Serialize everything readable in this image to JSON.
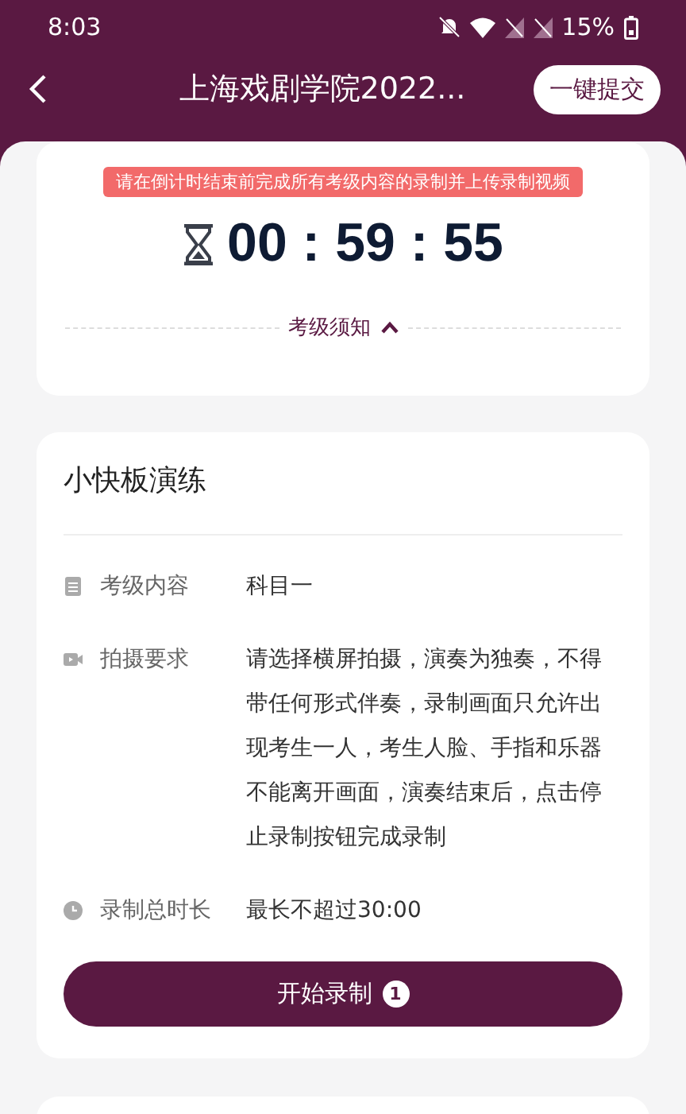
{
  "status_bar": {
    "time": "8:03",
    "battery": "15%"
  },
  "header": {
    "title": "上海戏剧学院2022...",
    "submit_button": "一键提交"
  },
  "timer": {
    "tip": "请在倒计时结束前完成所有考级内容的录制并上传录制视频",
    "countdown": "00 : 59 : 55",
    "notice": "考级须知",
    "notice_expanded": true
  },
  "task": {
    "title": "小快板演练",
    "details": [
      {
        "kind": "document",
        "label": "考级内容",
        "value": "科目一"
      },
      {
        "kind": "video",
        "label": "拍摄要求",
        "value": "请选择横屏拍摄，演奏为独奏，不得带任何形式伴奏，录制画面只允许出现考生一人，考生人脸、手指和乐器不能离开画面，演奏结束后，点击停止录制按钮完成录制"
      },
      {
        "kind": "clock",
        "label": "录制总时长",
        "value": "最长不超过30:00"
      }
    ],
    "button": "开始录制",
    "button_badge": "1"
  }
}
